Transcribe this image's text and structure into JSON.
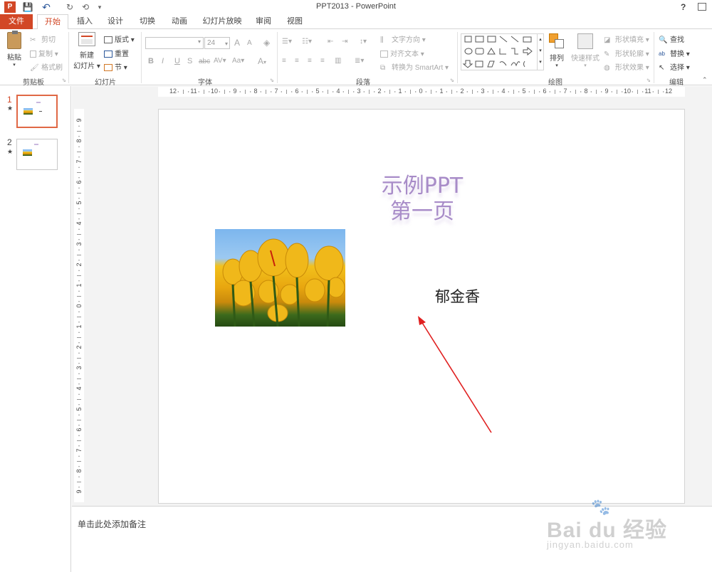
{
  "app": {
    "title": "PPT2013 - PowerPoint",
    "help": "?"
  },
  "quick_access": {
    "save": "💾",
    "undo": "↶",
    "redo": "↻",
    "customize": "▾"
  },
  "tabs": [
    {
      "label": "文件"
    },
    {
      "label": "开始"
    },
    {
      "label": "插入"
    },
    {
      "label": "设计"
    },
    {
      "label": "切换"
    },
    {
      "label": "动画"
    },
    {
      "label": "幻灯片放映"
    },
    {
      "label": "审阅"
    },
    {
      "label": "视图"
    }
  ],
  "ribbon": {
    "clipboard": {
      "paste": "粘贴",
      "cut": "剪切",
      "copy": "复制",
      "format_painter": "格式刷",
      "group": "剪贴板"
    },
    "slides": {
      "new_slide": "新建",
      "new_slide2": "幻灯片",
      "layout": "版式",
      "reset": "重置",
      "section": "节",
      "group": "幻灯片"
    },
    "font": {
      "size": "24",
      "group": "字体",
      "bold": "B",
      "italic": "I",
      "underline": "U",
      "shadow": "S",
      "strike": "abc",
      "aa": "Aa",
      "grow": "A",
      "shrink": "A",
      "fontcolor": "A",
      "spacing": "AV"
    },
    "paragraph": {
      "text_direction": "文字方向",
      "align_text": "对齐文本",
      "convert_smartart": "转换为 SmartArt",
      "group": "段落"
    },
    "drawing": {
      "arrange": "排列",
      "quick_styles": "快速样式",
      "shape_fill": "形状填充",
      "shape_outline": "形状轮廓",
      "shape_effects": "形状效果",
      "group": "绘图"
    },
    "editing": {
      "find": "查找",
      "replace": "替换",
      "select": "选择",
      "group": "编辑"
    }
  },
  "thumbnails": [
    {
      "num": "1",
      "star": "★"
    },
    {
      "num": "2",
      "star": "★"
    }
  ],
  "ruler": {
    "h": [
      "12",
      "11",
      "10",
      "9",
      "8",
      "7",
      "6",
      "5",
      "4",
      "3",
      "2",
      "1",
      "0",
      "1",
      "2",
      "3",
      "4",
      "5",
      "6",
      "7",
      "8",
      "9",
      "10",
      "11",
      "12"
    ],
    "v": [
      "9",
      "8",
      "7",
      "6",
      "5",
      "4",
      "3",
      "2",
      "1",
      "0",
      "1",
      "2",
      "3",
      "4",
      "5",
      "6",
      "7",
      "8",
      "9"
    ]
  },
  "slide": {
    "title_line1": "示例PPT",
    "title_line2": "第一页",
    "caption": "郁金香"
  },
  "notes": {
    "placeholder": "单击此处添加备注"
  },
  "watermark": {
    "brand": "Bai du 经验",
    "url": "jingyan.baidu.com"
  }
}
